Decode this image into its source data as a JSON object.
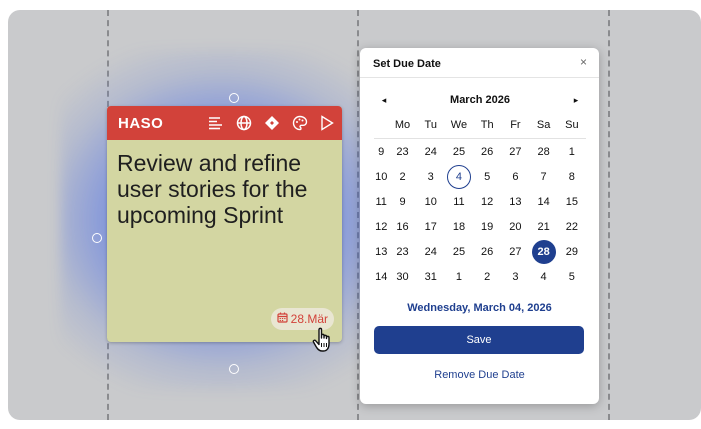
{
  "note": {
    "title": "HASO",
    "text": "Review and refine user stories for the upcoming Sprint",
    "due_chip": "28.Mär",
    "header_color": "#d2423a",
    "background_color": "#d3d6a2",
    "icons": [
      "align-left-icon",
      "globe-icon",
      "diamond-icon",
      "palette-icon",
      "play-icon"
    ]
  },
  "dialog": {
    "title": "Set Due Date",
    "close_label": "×",
    "prev_label": "◂",
    "next_label": "▸",
    "month_label": "March 2026",
    "weekdays": [
      "Mo",
      "Tu",
      "We",
      "Th",
      "Fr",
      "Sa",
      "Su"
    ],
    "weeks": [
      {
        "week": "9",
        "days": [
          "23",
          "24",
          "25",
          "26",
          "27",
          "28",
          "1"
        ]
      },
      {
        "week": "10",
        "days": [
          "2",
          "3",
          "4",
          "5",
          "6",
          "7",
          "8"
        ]
      },
      {
        "week": "11",
        "days": [
          "9",
          "10",
          "11",
          "12",
          "13",
          "14",
          "15"
        ]
      },
      {
        "week": "12",
        "days": [
          "16",
          "17",
          "18",
          "19",
          "20",
          "21",
          "22"
        ]
      },
      {
        "week": "13",
        "days": [
          "23",
          "24",
          "25",
          "26",
          "27",
          "28",
          "29"
        ]
      },
      {
        "week": "14",
        "days": [
          "30",
          "31",
          "1",
          "2",
          "3",
          "4",
          "5"
        ]
      }
    ],
    "today": {
      "week_index": 1,
      "day_index": 2
    },
    "selected": {
      "week_index": 4,
      "day_index": 5
    },
    "selected_date_label": "Wednesday, March 04, 2026",
    "save_label": "Save",
    "remove_label": "Remove Due Date",
    "accent_color": "#1f3f8f"
  }
}
